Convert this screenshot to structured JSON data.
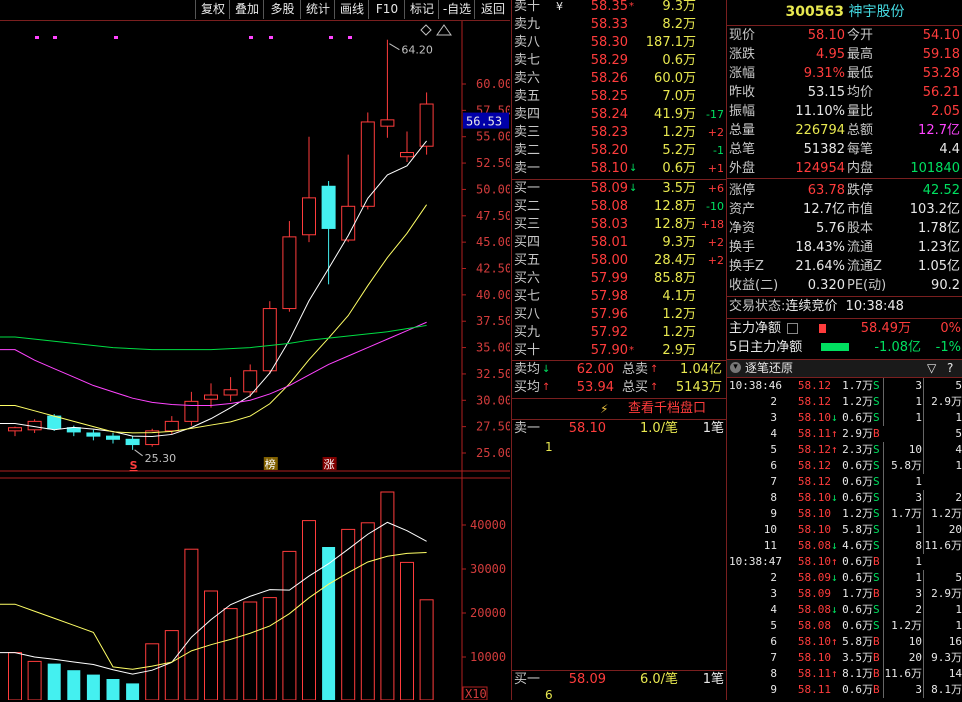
{
  "toolbar": {
    "buttons": [
      "复权",
      "叠加",
      "多股",
      "统计",
      "画线",
      "F10",
      "标记",
      "-自选",
      "返回"
    ]
  },
  "chart": {
    "price_axis_labels": [
      "60.00",
      "57.50",
      "55.00",
      "52.50",
      "50.00",
      "47.50",
      "45.00",
      "42.50",
      "40.00",
      "37.50",
      "35.00",
      "32.50",
      "30.00",
      "27.50",
      "25.00"
    ],
    "volume_axis_labels": [
      "40000",
      "30000",
      "20000",
      "10000"
    ],
    "volume_unit_label": "X10",
    "current_price_tag": "56.53",
    "high_annotation": "64.20",
    "low_annotation": "25.30",
    "markers": {
      "s_label": "S",
      "bang_label": "榜",
      "zhang_label": "涨"
    },
    "colors": {
      "up": "#ff3c3c",
      "down": "#44f0f0",
      "ma5": "#ffffff",
      "ma10": "#ffff66",
      "ma20": "#ff44ff",
      "ma60": "#00dd44",
      "axis": "#b02020"
    }
  },
  "chart_data": {
    "type": "candlestick",
    "price_ylim": [
      25,
      62
    ],
    "candles": [
      {
        "o": 27.1,
        "h": 27.5,
        "l": 26.6,
        "c": 27.4
      },
      {
        "o": 27.2,
        "h": 28.2,
        "l": 26.9,
        "c": 28.0
      },
      {
        "o": 28.5,
        "h": 28.7,
        "l": 27.1,
        "c": 27.3
      },
      {
        "o": 27.4,
        "h": 27.6,
        "l": 26.6,
        "c": 27.0
      },
      {
        "o": 26.9,
        "h": 27.2,
        "l": 26.2,
        "c": 26.6
      },
      {
        "o": 26.6,
        "h": 26.9,
        "l": 25.9,
        "c": 26.3
      },
      {
        "o": 26.3,
        "h": 26.6,
        "l": 25.3,
        "c": 25.8
      },
      {
        "o": 25.8,
        "h": 27.3,
        "l": 25.6,
        "c": 27.1
      },
      {
        "o": 27.1,
        "h": 28.5,
        "l": 26.8,
        "c": 28.0
      },
      {
        "o": 28.0,
        "h": 30.8,
        "l": 27.6,
        "c": 29.9
      },
      {
        "o": 30.1,
        "h": 31.6,
        "l": 29.3,
        "c": 30.5
      },
      {
        "o": 30.5,
        "h": 32.2,
        "l": 29.9,
        "c": 31.0
      },
      {
        "o": 30.8,
        "h": 33.4,
        "l": 30.3,
        "c": 32.8
      },
      {
        "o": 32.8,
        "h": 39.4,
        "l": 32.5,
        "c": 38.7
      },
      {
        "o": 38.7,
        "h": 47.0,
        "l": 38.4,
        "c": 45.5
      },
      {
        "o": 45.7,
        "h": 55.0,
        "l": 45.0,
        "c": 49.2
      },
      {
        "o": 50.3,
        "h": 50.8,
        "l": 41.0,
        "c": 46.3
      },
      {
        "o": 45.2,
        "h": 53.3,
        "l": 45.0,
        "c": 48.4
      },
      {
        "o": 48.4,
        "h": 57.3,
        "l": 48.1,
        "c": 56.4
      },
      {
        "o": 56.0,
        "h": 64.2,
        "l": 54.9,
        "c": 56.6
      },
      {
        "o": 53.1,
        "h": 55.5,
        "l": 52.6,
        "c": 53.5
      },
      {
        "o": 54.1,
        "h": 59.2,
        "l": 53.3,
        "c": 58.1
      }
    ],
    "volume": [
      11000,
      9000,
      8500,
      7000,
      6000,
      5000,
      4000,
      13000,
      16000,
      34500,
      25000,
      21000,
      22500,
      23500,
      34000,
      41000,
      35000,
      39000,
      40500,
      47500,
      31500,
      23000
    ],
    "volume_ylim": [
      0,
      48000
    ]
  },
  "stock": {
    "code": "300563",
    "name": "神宇股份"
  },
  "order_book": {
    "asks": [
      {
        "label": "卖十",
        "mark": "¥",
        "price": "58.35",
        "arrow": "*",
        "vol": "9.3万",
        "chg": ""
      },
      {
        "label": "卖九",
        "mark": "",
        "price": "58.33",
        "arrow": "",
        "vol": "8.2万",
        "chg": ""
      },
      {
        "label": "卖八",
        "mark": "",
        "price": "58.30",
        "arrow": "",
        "vol": "187.1万",
        "chg": ""
      },
      {
        "label": "卖七",
        "mark": "",
        "price": "58.29",
        "arrow": "",
        "vol": "0.6万",
        "chg": ""
      },
      {
        "label": "卖六",
        "mark": "",
        "price": "58.26",
        "arrow": "",
        "vol": "60.0万",
        "chg": ""
      },
      {
        "label": "卖五",
        "mark": "",
        "price": "58.25",
        "arrow": "",
        "vol": "7.0万",
        "chg": ""
      },
      {
        "label": "卖四",
        "mark": "",
        "price": "58.24",
        "arrow": "",
        "vol": "41.9万",
        "chg": "-17"
      },
      {
        "label": "卖三",
        "mark": "",
        "price": "58.23",
        "arrow": "",
        "vol": "1.2万",
        "chg": "+2"
      },
      {
        "label": "卖二",
        "mark": "",
        "price": "58.20",
        "arrow": "",
        "vol": "5.2万",
        "chg": "-1"
      },
      {
        "label": "卖一",
        "mark": "",
        "price": "58.10",
        "arrow": "↓",
        "vol": "0.6万",
        "chg": "+1"
      }
    ],
    "bids": [
      {
        "label": "买一",
        "price": "58.09",
        "arrow": "↓",
        "vol": "3.5万",
        "chg": "+6"
      },
      {
        "label": "买二",
        "price": "58.08",
        "arrow": "",
        "vol": "12.8万",
        "chg": "-10"
      },
      {
        "label": "买三",
        "price": "58.03",
        "arrow": "",
        "vol": "12.8万",
        "chg": "+18"
      },
      {
        "label": "买四",
        "price": "58.01",
        "arrow": "",
        "vol": "9.3万",
        "chg": "+2"
      },
      {
        "label": "买五",
        "price": "58.00",
        "arrow": "",
        "vol": "28.4万",
        "chg": "+2"
      },
      {
        "label": "买六",
        "price": "57.99",
        "arrow": "",
        "vol": "85.8万",
        "chg": ""
      },
      {
        "label": "买七",
        "price": "57.98",
        "arrow": "",
        "vol": "4.1万",
        "chg": ""
      },
      {
        "label": "买八",
        "price": "57.96",
        "arrow": "",
        "vol": "1.2万",
        "chg": ""
      },
      {
        "label": "买九",
        "price": "57.92",
        "arrow": "",
        "vol": "1.2万",
        "chg": ""
      },
      {
        "label": "买十",
        "price": "57.90",
        "arrow": "*",
        "vol": "2.9万",
        "chg": ""
      }
    ],
    "summary": {
      "ask_avg_label": "卖均",
      "ask_avg": "62.00",
      "ask_total_label": "总卖",
      "ask_total": "1.04亿",
      "bid_avg_label": "买均",
      "bid_avg": "53.94",
      "bid_total_label": "总买",
      "bid_total": "5143万"
    },
    "view_thousand_label": "查看千档盘口",
    "queue_ask": {
      "label": "卖一",
      "price": "58.10",
      "qty": "1.0/笔",
      "count": "1笔",
      "first": "1"
    },
    "queue_bid": {
      "label": "买一",
      "price": "58.09",
      "qty": "6.0/笔",
      "count": "1笔",
      "first": "6"
    }
  },
  "quote": {
    "rows": [
      {
        "l1": "现价",
        "v1": "58.10",
        "c1": "#ff3c3c",
        "l2": "今开",
        "v2": "54.10",
        "c2": "#ff3c3c"
      },
      {
        "l1": "涨跌",
        "v1": "4.95",
        "c1": "#ff3c3c",
        "l2": "最高",
        "v2": "59.18",
        "c2": "#ff3c3c"
      },
      {
        "l1": "涨幅",
        "v1": "9.31%",
        "c1": "#ff3c3c",
        "l2": "最低",
        "v2": "53.28",
        "c2": "#ff3c3c"
      },
      {
        "l1": "昨收",
        "v1": "53.15",
        "c1": "#e8e8e8",
        "l2": "均价",
        "v2": "56.21",
        "c2": "#ff3c3c"
      },
      {
        "l1": "振幅",
        "v1": "11.10%",
        "c1": "#e8e8e8",
        "l2": "量比",
        "v2": "2.05",
        "c2": "#ff3c3c"
      },
      {
        "l1": "总量",
        "v1": "226794",
        "c1": "#e8e850",
        "l2": "总额",
        "v2": "12.7亿",
        "c2": "#ff44ff"
      },
      {
        "l1": "总笔",
        "v1": "51382",
        "c1": "#e8e8e8",
        "l2": "每笔",
        "v2": "4.4",
        "c2": "#e8e8e8"
      },
      {
        "l1": "外盘",
        "v1": "124954",
        "c1": "#ff3c3c",
        "l2": "内盘",
        "v2": "101840",
        "c2": "#00e060"
      },
      {
        "l1": "涨停",
        "v1": "63.78",
        "c1": "#ff3c3c",
        "l2": "跌停",
        "v2": "42.52",
        "c2": "#00e060"
      },
      {
        "l1": "资产",
        "v1": "12.7亿",
        "c1": "#e8e8e8",
        "l2": "市值",
        "v2": "103.2亿",
        "c2": "#e8e8e8"
      },
      {
        "l1": "净资",
        "v1": "5.76",
        "c1": "#e8e8e8",
        "l2": "股本",
        "v2": "1.78亿",
        "c2": "#e8e8e8"
      },
      {
        "l1": "换手",
        "v1": "18.43%",
        "c1": "#e8e8e8",
        "l2": "流通",
        "v2": "1.23亿",
        "c2": "#e8e8e8"
      },
      {
        "l1": "换手Z",
        "v1": "21.64%",
        "c1": "#e8e8e8",
        "l2": "流通Z",
        "v2": "1.05亿",
        "c2": "#e8e8e8"
      },
      {
        "l1": "收益(二)",
        "v1": "0.320",
        "c1": "#e8e8e8",
        "l2": "PE(动)",
        "v2": "90.2",
        "c2": "#e8e8e8"
      }
    ],
    "status_label": "交易状态:",
    "status_value": "连续竞价",
    "status_time": "10:38:48",
    "main_net_label": "主力净额",
    "main_net_value": "58.49万",
    "main_net_pct": "0%",
    "main_net_5d_label": "5日主力净额",
    "main_net_5d_value": "-1.08亿",
    "main_net_5d_pct": "-1%",
    "tick_header": "逐笔还原",
    "tick_header_icons": {
      "filter": "▽",
      "help": "?"
    },
    "ticks": [
      {
        "t": "10:38:46",
        "p": "58.12",
        "a": "",
        "v": "1.7万",
        "s": "S",
        "n": "3",
        "m": "5",
        "pc": "#ff3c3c",
        "sc": "#00e060"
      },
      {
        "t": "2",
        "p": "58.12",
        "a": "",
        "v": "1.2万",
        "s": "S",
        "n": "1",
        "m": "2.9万",
        "pc": "#ff3c3c",
        "sc": "#00e060"
      },
      {
        "t": "3",
        "p": "58.10",
        "a": "↓",
        "v": "0.6万",
        "s": "S",
        "n": "1",
        "m": "1",
        "pc": "#ff3c3c",
        "sc": "#00e060"
      },
      {
        "t": "4",
        "p": "58.11",
        "a": "↑",
        "v": "2.9万",
        "s": "B",
        "n": "",
        "m": "5",
        "pc": "#ff3c3c",
        "sc": "#ff3c3c"
      },
      {
        "t": "5",
        "p": "58.12",
        "a": "↑",
        "v": "2.3万",
        "s": "S",
        "n": "10",
        "m": "4",
        "pc": "#ff3c3c",
        "sc": "#00e060"
      },
      {
        "t": "6",
        "p": "58.12",
        "a": "",
        "v": "0.6万",
        "s": "S",
        "n": "5.8万",
        "m": "1",
        "pc": "#ff3c3c",
        "sc": "#00e060"
      },
      {
        "t": "7",
        "p": "58.12",
        "a": "",
        "v": "0.6万",
        "s": "S",
        "n": "1",
        "m": "",
        "pc": "#ff3c3c",
        "sc": "#00e060"
      },
      {
        "t": "8",
        "p": "58.10",
        "a": "↓",
        "v": "0.6万",
        "s": "S",
        "n": "3",
        "m": "2",
        "pc": "#ff3c3c",
        "sc": "#00e060"
      },
      {
        "t": "9",
        "p": "58.10",
        "a": "",
        "v": "1.2万",
        "s": "S",
        "n": "1.7万",
        "m": "1.2万",
        "pc": "#ff3c3c",
        "sc": "#00e060"
      },
      {
        "t": "10",
        "p": "58.10",
        "a": "",
        "v": "5.8万",
        "s": "S",
        "n": "1",
        "m": "20",
        "pc": "#ff3c3c",
        "sc": "#00e060"
      },
      {
        "t": "11",
        "p": "58.08",
        "a": "↓",
        "v": "4.6万",
        "s": "S",
        "n": "8",
        "m": "11.6万",
        "pc": "#ff3c3c",
        "sc": "#00e060"
      },
      {
        "t": "10:38:47",
        "p": "58.10",
        "a": "↑",
        "v": "0.6万",
        "s": "B",
        "n": "1",
        "m": "",
        "pc": "#ff3c3c",
        "sc": "#ff3c3c"
      },
      {
        "t": "2",
        "p": "58.09",
        "a": "↓",
        "v": "0.6万",
        "s": "S",
        "n": "1",
        "m": "5",
        "pc": "#ff3c3c",
        "sc": "#00e060"
      },
      {
        "t": "3",
        "p": "58.09",
        "a": "",
        "v": "1.7万",
        "s": "B",
        "n": "3",
        "m": "2.9万",
        "pc": "#ff3c3c",
        "sc": "#ff3c3c"
      },
      {
        "t": "4",
        "p": "58.08",
        "a": "↓",
        "v": "0.6万",
        "s": "S",
        "n": "2",
        "m": "1",
        "pc": "#ff3c3c",
        "sc": "#00e060"
      },
      {
        "t": "5",
        "p": "58.08",
        "a": "",
        "v": "0.6万",
        "s": "S",
        "n": "1.2万",
        "m": "1",
        "pc": "#ff3c3c",
        "sc": "#00e060"
      },
      {
        "t": "6",
        "p": "58.10",
        "a": "↑",
        "v": "5.8万",
        "s": "B",
        "n": "10",
        "m": "16",
        "pc": "#ff3c3c",
        "sc": "#ff3c3c"
      },
      {
        "t": "7",
        "p": "58.10",
        "a": "",
        "v": "3.5万",
        "s": "B",
        "n": "20",
        "m": "9.3万",
        "pc": "#ff3c3c",
        "sc": "#ff3c3c"
      },
      {
        "t": "8",
        "p": "58.11",
        "a": "↑",
        "v": "8.1万",
        "s": "B",
        "n": "11.6万",
        "m": "14",
        "pc": "#ff3c3c",
        "sc": "#ff3c3c"
      },
      {
        "t": "9",
        "p": "58.11",
        "a": "",
        "v": "0.6万",
        "s": "B",
        "n": "3",
        "m": "8.1万",
        "pc": "#ff3c3c",
        "sc": "#ff3c3c"
      }
    ]
  }
}
